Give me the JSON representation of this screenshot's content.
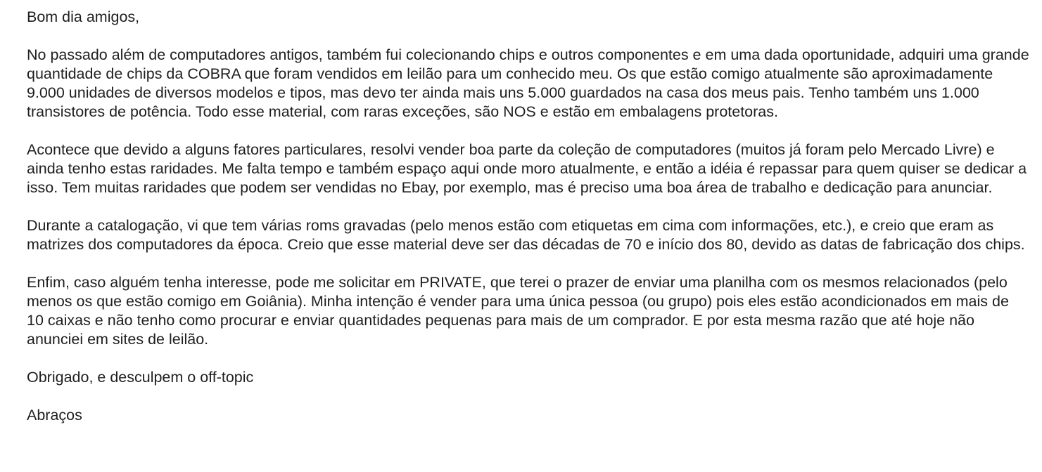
{
  "message": {
    "greeting": "Bom dia amigos,",
    "paragraphs": [
      "No passado além de computadores antigos, também fui colecionando chips e outros componentes e em uma dada oportunidade, adquiri uma grande quantidade de chips da COBRA que foram vendidos em leilão para um conhecido meu. Os que estão comigo atualmente são aproximadamente 9.000 unidades de diversos modelos e tipos, mas devo ter ainda mais uns 5.000 guardados na casa dos meus pais. Tenho também uns 1.000 transistores de potência. Todo esse material, com raras exceções, são NOS e estão em embalagens protetoras.",
      "Acontece que devido a alguns fatores particulares, resolvi vender boa parte da coleção de computadores (muitos já foram pelo Mercado Livre) e ainda tenho estas raridades. Me falta tempo e também espaço aqui onde moro atualmente, e então a idéia é repassar para quem quiser se dedicar a isso. Tem muitas raridades que podem ser vendidas no Ebay, por exemplo, mas é preciso uma boa área de trabalho e dedicação para anunciar.",
      "Durante a catalogação, vi que tem várias roms gravadas (pelo menos estão com etiquetas em cima com informações, etc.), e creio que eram as matrizes dos computadores da época. Creio que esse material deve ser das décadas de 70 e início dos 80, devido as datas de fabricação dos chips.",
      "Enfim, caso alguém tenha interesse, pode me solicitar em PRIVATE, que terei o prazer de enviar uma planilha com os mesmos relacionados (pelo menos os que estão comigo em Goiânia). Minha intenção é vender para uma única pessoa (ou grupo) pois eles estão acondicionados em mais de 10 caixas e não tenho como procurar e enviar quantidades pequenas para mais de um comprador. E por esta mesma razão que até hoje não anunciei em sites de leilão."
    ],
    "closing": "Obrigado, e desculpem o off-topic",
    "signoff": "Abraços"
  }
}
